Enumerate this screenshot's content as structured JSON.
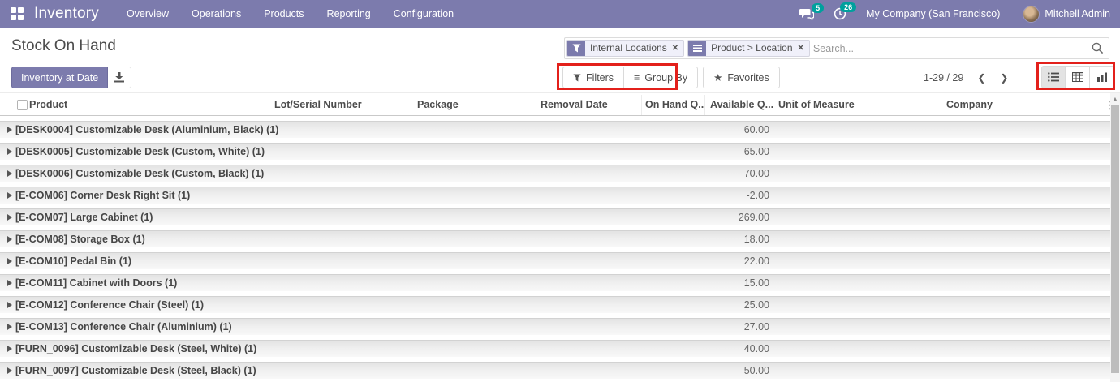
{
  "colors": {
    "nav_accent": "#7C7BAD",
    "badge": "#00A09D",
    "annotation": "#E3201B"
  },
  "icons": {
    "star": "★",
    "bars": "≡",
    "dots": "⋮",
    "prev": "❮",
    "next": "❯",
    "remove": "✕",
    "up_arrow": "▲"
  },
  "nav": {
    "app_name": "Inventory",
    "menus": [
      "Overview",
      "Operations",
      "Products",
      "Reporting",
      "Configuration"
    ],
    "messages_count": "5",
    "activities_count": "26",
    "company": "My Company (San Francisco)",
    "user": "Mitchell Admin"
  },
  "page": {
    "title": "Stock On Hand"
  },
  "search": {
    "placeholder": "Search...",
    "facets": [
      {
        "icon": "filter-icon",
        "label": "Internal Locations"
      },
      {
        "icon": "group-by-icon",
        "label": "Product > Location"
      }
    ]
  },
  "controls": {
    "inventory_at_date": "Inventory at Date",
    "filters": "Filters",
    "group_by": "Group By",
    "favorites": "Favorites",
    "pager": "1-29 / 29"
  },
  "table": {
    "columns": [
      "Product",
      "Lot/Serial Number",
      "Package",
      "Removal Date",
      "On Hand Q...",
      "Available Q...",
      "Unit of Measure",
      "Company"
    ],
    "rows": [
      {
        "product": "[DESK0004] Customizable Desk (Aluminium, Black) (1)",
        "qty": "60.00"
      },
      {
        "product": "[DESK0005] Customizable Desk (Custom, White) (1)",
        "qty": "65.00"
      },
      {
        "product": "[DESK0006] Customizable Desk (Custom, Black) (1)",
        "qty": "70.00"
      },
      {
        "product": "[E-COM06] Corner Desk Right Sit (1)",
        "qty": "-2.00"
      },
      {
        "product": "[E-COM07] Large Cabinet (1)",
        "qty": "269.00"
      },
      {
        "product": "[E-COM08] Storage Box (1)",
        "qty": "18.00"
      },
      {
        "product": "[E-COM10] Pedal Bin (1)",
        "qty": "22.00"
      },
      {
        "product": "[E-COM11] Cabinet with Doors (1)",
        "qty": "15.00"
      },
      {
        "product": "[E-COM12] Conference Chair (Steel) (1)",
        "qty": "25.00"
      },
      {
        "product": "[E-COM13] Conference Chair (Aluminium) (1)",
        "qty": "27.00"
      },
      {
        "product": "[FURN_0096] Customizable Desk (Steel, White) (1)",
        "qty": "40.00"
      },
      {
        "product": "[FURN_0097] Customizable Desk (Steel, Black) (1)",
        "qty": "50.00"
      }
    ]
  }
}
